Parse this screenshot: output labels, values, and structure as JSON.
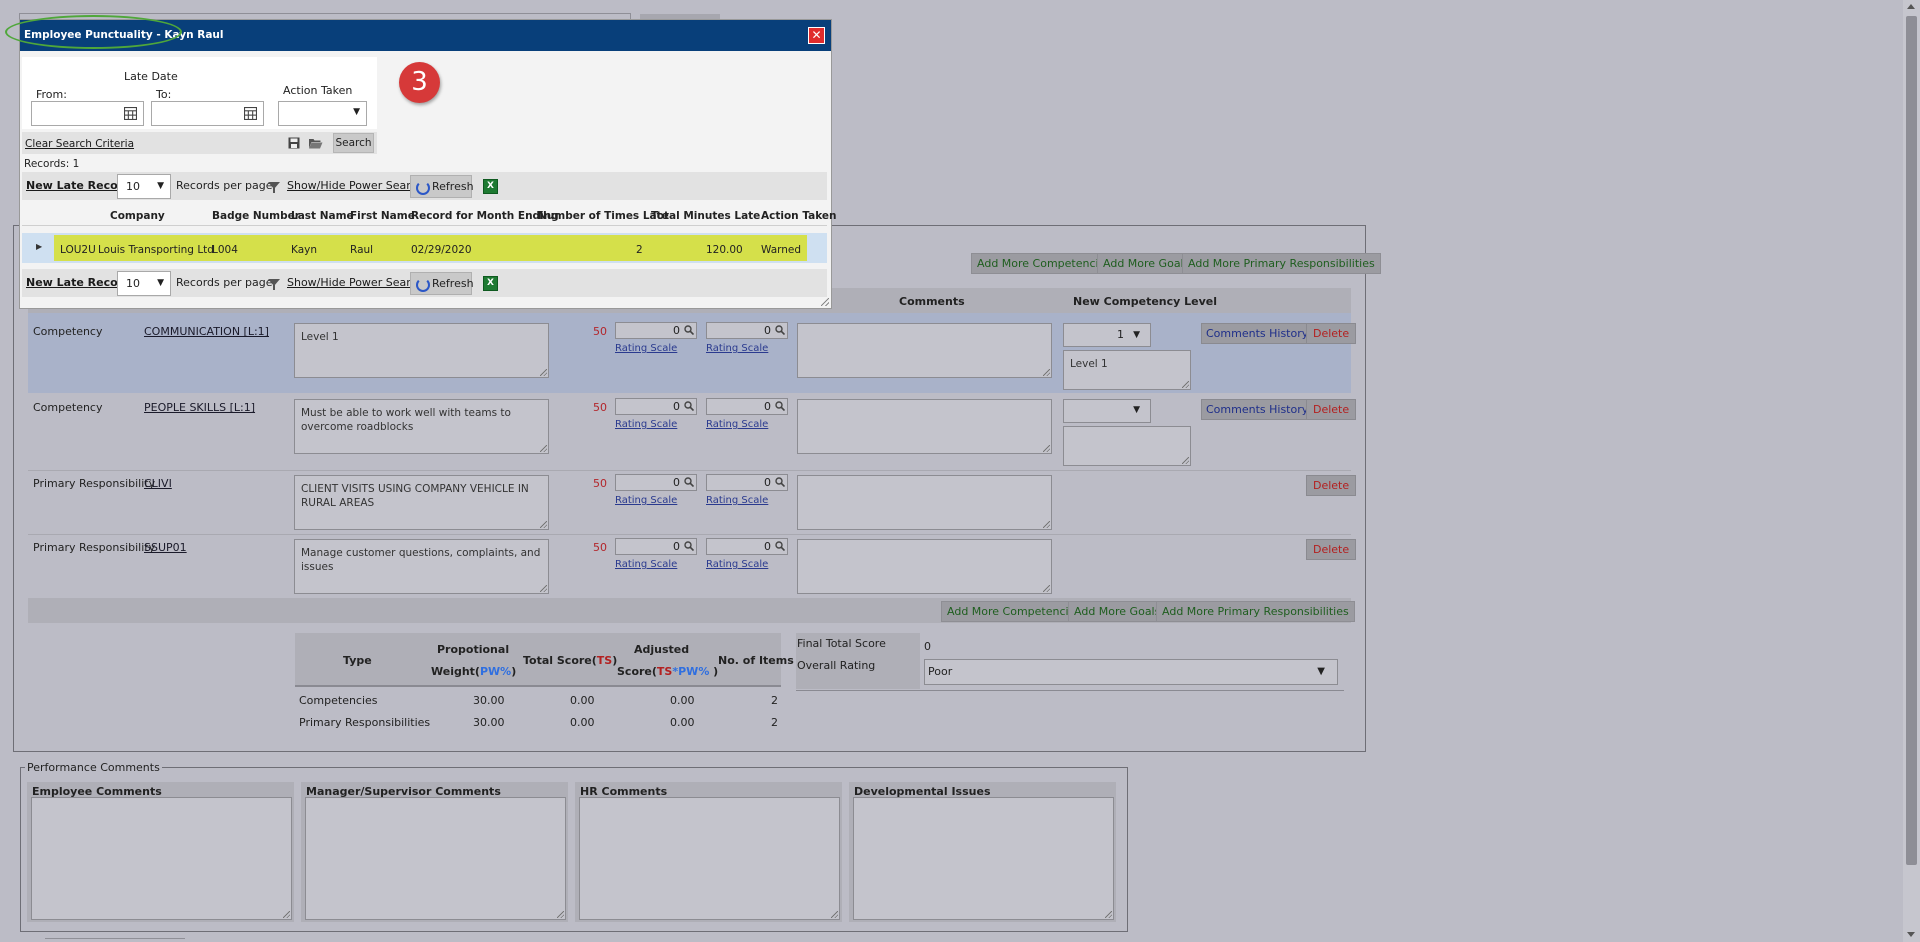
{
  "modal": {
    "title": "Employee Punctuality - Kayn Raul",
    "close": "✕",
    "step_number": "3",
    "filters": {
      "late_date_label": "Late Date",
      "from_label": "From:",
      "to_label": "To:",
      "action_label": "Action Taken"
    },
    "clear_search": "Clear Search Criteria",
    "search_button": "Search",
    "records_count": "Records:  1",
    "toolbar": {
      "new_record": "New Late Record",
      "per_page_value": "10",
      "per_page_label": "Records per page",
      "power_search": "Show/Hide Power Search",
      "refresh": "Refresh"
    },
    "columns": [
      "Company",
      "Badge Number",
      "Last Name",
      "First Name",
      "Record for Month Ending",
      "Number of Times Late",
      "Total Minutes Late",
      "Action Taken"
    ],
    "row": {
      "company_code": "LOU2U",
      "company_name": "Louis Transporting Ltd",
      "badge": "L004",
      "last_name": "Kayn",
      "first_name": "Raul",
      "month_ending": "02/29/2020",
      "times_late": "2",
      "minutes_late": "120.00",
      "action": "Warned"
    }
  },
  "top_buttons": {
    "add_competencies": "Add More Competencies",
    "add_goals": "Add More Goals",
    "add_responsibilities": "Add More Primary Responsibilities"
  },
  "grid_headers": {
    "comments": "Comments",
    "new_level": "New Competency Level"
  },
  "rows": [
    {
      "type": "Competency",
      "code": "COMMUNICATION [L:1]",
      "desc": "Level 1",
      "weight": "50",
      "score1": "0",
      "score2": "0",
      "rating": "Rating Scale",
      "level": "1",
      "level_desc": "Level 1",
      "history": "Comments History",
      "delete": "Delete"
    },
    {
      "type": "Competency",
      "code": "PEOPLE SKILLS [L:1]",
      "desc": "Must be able to work well with teams to overcome roadblocks",
      "weight": "50",
      "score1": "0",
      "score2": "0",
      "rating": "Rating Scale",
      "level": "",
      "level_desc": "",
      "history": "Comments History",
      "delete": "Delete"
    },
    {
      "type": "Primary Responsibility",
      "code": "CLIVI",
      "desc": "CLIENT VISITS USING COMPANY VEHICLE IN RURAL AREAS",
      "weight": "50",
      "score1": "0",
      "score2": "0",
      "rating": "Rating Scale",
      "delete": "Delete"
    },
    {
      "type": "Primary Responsibility",
      "code": "SSUP01",
      "desc": "Manage customer questions, complaints, and issues",
      "weight": "50",
      "score1": "0",
      "score2": "0",
      "rating": "Rating Scale",
      "delete": "Delete"
    }
  ],
  "summary": {
    "h_type": "Type",
    "h_weight_line1": "Propotional",
    "h_weight_line2a": "Weight(",
    "h_weight_line2b": "PW%",
    "h_weight_line2c": ")",
    "h_total_a": "Total Score(",
    "h_total_b": "TS",
    "h_total_c": ")",
    "h_adj_line1": "Adjusted",
    "h_adj_a": "Score(",
    "h_adj_b": "TS",
    "h_adj_c": "*",
    "h_adj_d": "PW%",
    "h_adj_e": " )",
    "h_items": "No. of Items",
    "rows": [
      {
        "type": "Competencies",
        "weight": "30.00",
        "total": "0.00",
        "adjusted": "0.00",
        "items": "2"
      },
      {
        "type": "Primary Responsibilities",
        "weight": "30.00",
        "total": "0.00",
        "adjusted": "0.00",
        "items": "2"
      }
    ],
    "final_label": "Final Total Score",
    "final_value": "0",
    "overall_label": "Overall Rating",
    "overall_value": "Poor"
  },
  "performance": {
    "legend": "Performance Comments",
    "employee": "Employee Comments",
    "manager": "Manager/Supervisor Comments",
    "hr": "HR Comments",
    "developmental": "Developmental Issues"
  },
  "colors": {
    "backdrop": "#bcbcc6",
    "modal_title": "#083f7a",
    "row_highlight": "#d5e04a",
    "close": "#e02c2c",
    "badge": "#d63939"
  }
}
